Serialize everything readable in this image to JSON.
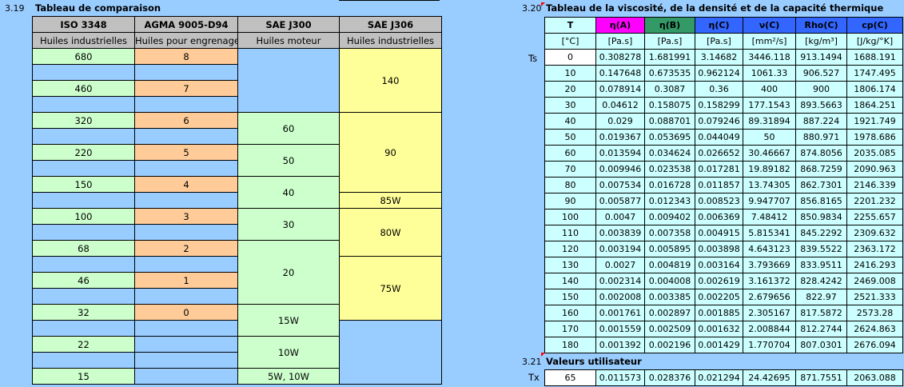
{
  "section19": {
    "number": "3.19",
    "title": "Tableau de comparaison",
    "headers": [
      "ISO 3348",
      "AGMA 9005-D94",
      "SAE J300",
      "SAE J306"
    ],
    "subheaders": [
      "Huiles industrielles",
      "Huiles pour engrenages",
      "Huiles moteur",
      "Huiles industrielles"
    ],
    "iso": [
      "680",
      "",
      "460",
      "",
      "320",
      "",
      "220",
      "",
      "150",
      "",
      "100",
      "",
      "68",
      "",
      "46",
      "",
      "32",
      "",
      "22",
      "",
      "15"
    ],
    "agma": [
      "8",
      "",
      "7",
      "",
      "6",
      "",
      "5",
      "",
      "4",
      "",
      "3",
      "",
      "2",
      "",
      "1",
      "",
      "0",
      "",
      "",
      "",
      ""
    ],
    "sae300": [
      "60",
      "50",
      "40",
      "30",
      "20",
      "15W",
      "10W",
      "5W, 10W"
    ],
    "sae306": [
      "140",
      "90",
      "85W",
      "80W",
      "75W"
    ]
  },
  "section20": {
    "number": "3.20",
    "title": "Tableau de la viscosité, de la densité et de la capacité thermique",
    "headers": [
      "T",
      "η(A)",
      "η(B)",
      "η(C)",
      "ν(C)",
      "Rho(C)",
      "cp(C)"
    ],
    "units": [
      "[°C]",
      "[Pa.s]",
      "[Pa.s]",
      "[Pa.s]",
      "[mm²/s]",
      "[kg/m³]",
      "[J/kg/°K]"
    ],
    "row_label": "Ts",
    "rows": [
      [
        "0",
        "0.308278",
        "1.681991",
        "3.14682",
        "3446.118",
        "913.1494",
        "1688.191"
      ],
      [
        "10",
        "0.147648",
        "0.673535",
        "0.962124",
        "1061.33",
        "906.527",
        "1747.495"
      ],
      [
        "20",
        "0.078914",
        "0.3087",
        "0.36",
        "400",
        "900",
        "1806.174"
      ],
      [
        "30",
        "0.04612",
        "0.158075",
        "0.158299",
        "177.1543",
        "893.5663",
        "1864.251"
      ],
      [
        "40",
        "0.029",
        "0.088701",
        "0.079246",
        "89.31894",
        "887.224",
        "1921.749"
      ],
      [
        "50",
        "0.019367",
        "0.053695",
        "0.044049",
        "50",
        "880.971",
        "1978.686"
      ],
      [
        "60",
        "0.013594",
        "0.034624",
        "0.026652",
        "30.46667",
        "874.8056",
        "2035.085"
      ],
      [
        "70",
        "0.009946",
        "0.023538",
        "0.017281",
        "19.89182",
        "868.7259",
        "2090.963"
      ],
      [
        "80",
        "0.007534",
        "0.016728",
        "0.011857",
        "13.74305",
        "862.7301",
        "2146.339"
      ],
      [
        "90",
        "0.005877",
        "0.012343",
        "0.008523",
        "9.947707",
        "856.8165",
        "2201.232"
      ],
      [
        "100",
        "0.0047",
        "0.009402",
        "0.006369",
        "7.48412",
        "850.9834",
        "2255.657"
      ],
      [
        "110",
        "0.003839",
        "0.007358",
        "0.004915",
        "5.815341",
        "845.2292",
        "2309.632"
      ],
      [
        "120",
        "0.003194",
        "0.005895",
        "0.003898",
        "4.643123",
        "839.5522",
        "2363.172"
      ],
      [
        "130",
        "0.0027",
        "0.004819",
        "0.003164",
        "3.793669",
        "833.9511",
        "2416.293"
      ],
      [
        "140",
        "0.002314",
        "0.004008",
        "0.002619",
        "3.161372",
        "828.4242",
        "2469.008"
      ],
      [
        "150",
        "0.002008",
        "0.003385",
        "0.002205",
        "2.679656",
        "822.97",
        "2521.333"
      ],
      [
        "160",
        "0.001761",
        "0.002897",
        "0.001885",
        "2.305167",
        "817.5872",
        "2573.28"
      ],
      [
        "170",
        "0.001559",
        "0.002509",
        "0.001632",
        "2.008844",
        "812.2744",
        "2624.863"
      ],
      [
        "180",
        "0.001392",
        "0.002196",
        "0.001429",
        "1.770704",
        "807.0301",
        "2676.094"
      ]
    ]
  },
  "section21": {
    "number": "3.21",
    "title": "Valeurs utilisateur",
    "row_label": "Tx",
    "row": [
      "65",
      "0.011573",
      "0.028376",
      "0.021294",
      "24.42695",
      "871.7551",
      "2063.088"
    ]
  }
}
